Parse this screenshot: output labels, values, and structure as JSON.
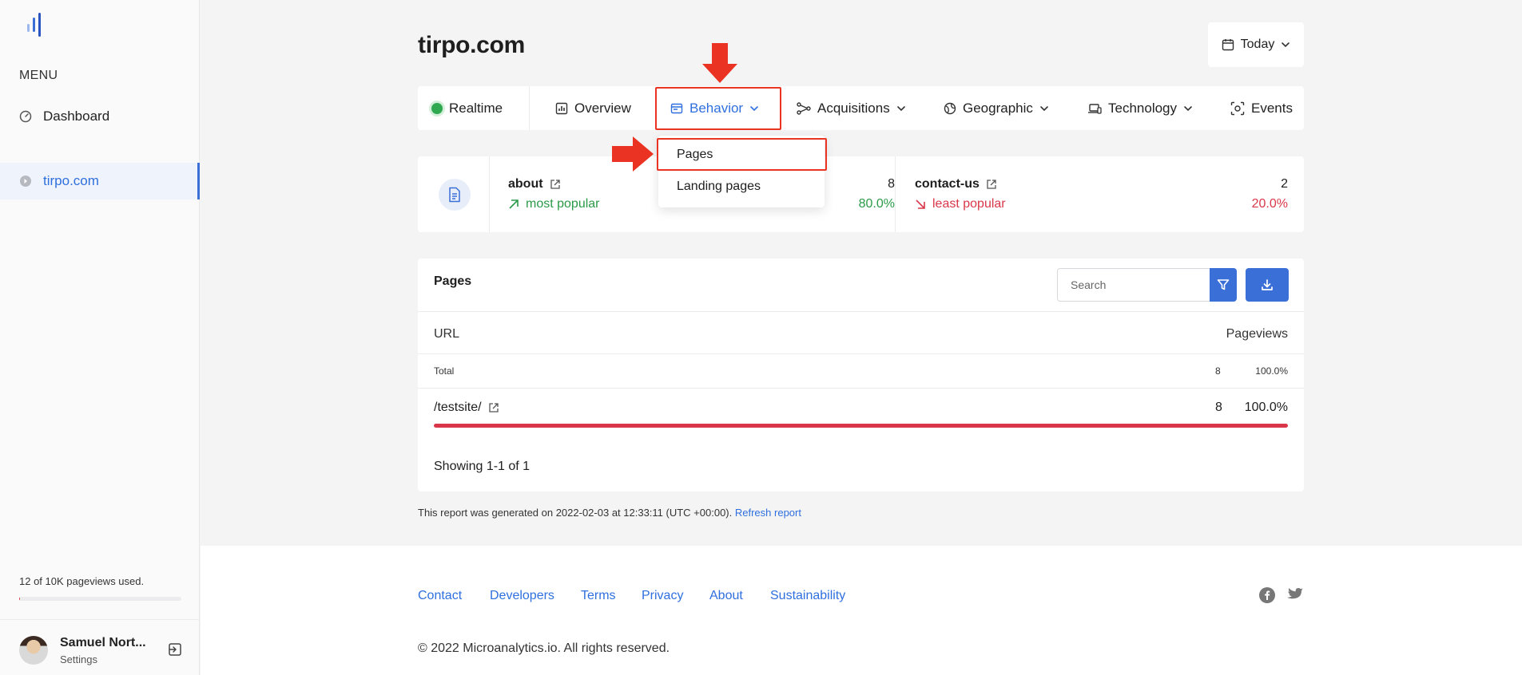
{
  "sidebar": {
    "menu_label": "MENU",
    "items": [
      {
        "label": "Dashboard",
        "icon": "dashboard-gauge-icon"
      },
      {
        "label": "tirpo.com",
        "icon": "site-dot-icon",
        "active": true
      }
    ],
    "usage_text": "12 of 10K pageviews used.",
    "usage_fraction": 0.0012,
    "user": {
      "name": "Samuel Nort...",
      "subtitle": "Settings"
    }
  },
  "header": {
    "site_title": "tirpo.com",
    "date_range": "Today"
  },
  "tabs": [
    {
      "label": "Realtime",
      "icon": "realtime-dot-icon"
    },
    {
      "label": "Overview",
      "icon": "chart-icon"
    },
    {
      "label": "Behavior",
      "icon": "window-icon",
      "active": true
    },
    {
      "label": "Acquisitions",
      "icon": "share-icon"
    },
    {
      "label": "Geographic",
      "icon": "globe-icon"
    },
    {
      "label": "Technology",
      "icon": "devices-icon"
    },
    {
      "label": "Events",
      "icon": "target-icon"
    }
  ],
  "dropdown": {
    "items": [
      "Pages",
      "Landing pages"
    ]
  },
  "stats": {
    "most": {
      "name": "about",
      "trend": "most popular",
      "count": "8",
      "pct": "80.0%"
    },
    "least": {
      "name": "contact-us",
      "trend": "least popular",
      "count": "2",
      "pct": "20.0%"
    }
  },
  "pages_panel": {
    "title": "Pages",
    "search_placeholder": "Search",
    "columns": {
      "url": "URL",
      "pageviews": "Pageviews"
    },
    "total": {
      "label": "Total",
      "count": "8",
      "pct": "100.0%"
    },
    "rows": [
      {
        "url": "/testsite/",
        "count": "8",
        "pct": "100.0%",
        "fraction": 1.0
      }
    ],
    "showing": "Showing 1-1 of 1"
  },
  "report": {
    "text": "This report was generated on 2022-02-03 at 12:33:11 (UTC +00:00).",
    "refresh": "Refresh report"
  },
  "footer": {
    "links": [
      "Contact",
      "Developers",
      "Terms",
      "Privacy",
      "About",
      "Sustainability"
    ],
    "copyright": "© 2022 Microanalytics.io. All rights reserved."
  },
  "colors": {
    "accent": "#3a6fd8",
    "positive": "#2b9a48",
    "negative": "#d93749",
    "annotation": "#ea3323"
  }
}
